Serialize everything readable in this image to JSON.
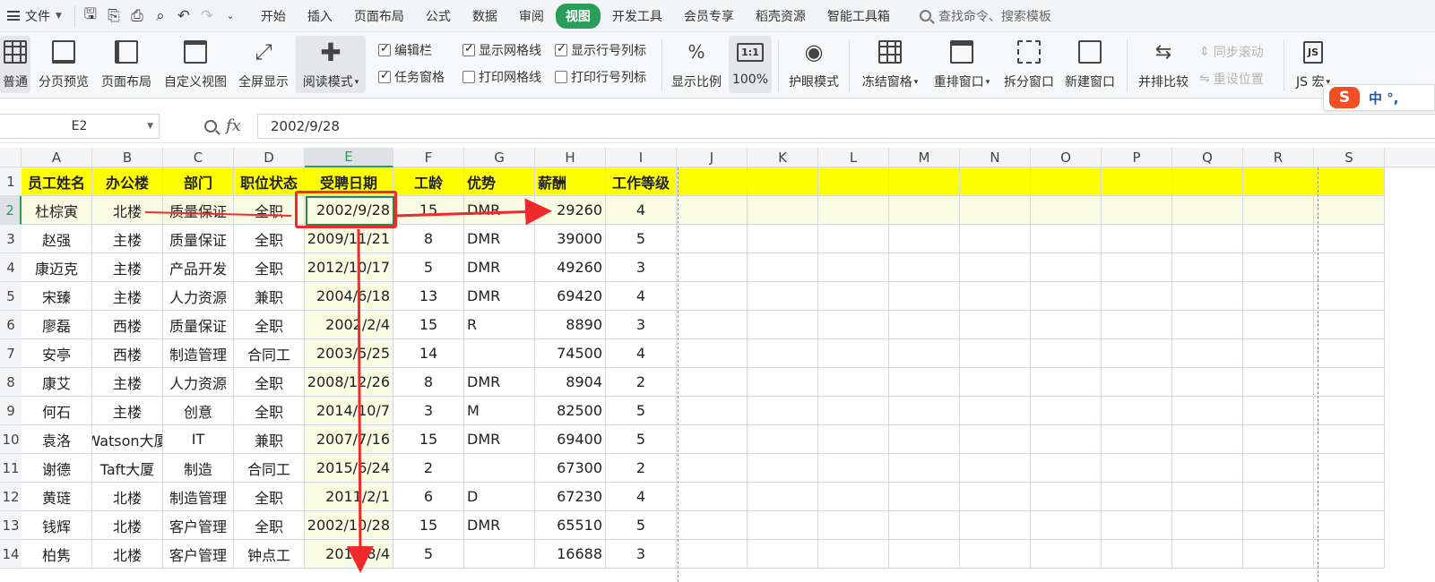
{
  "menu": {
    "file": "文件",
    "tabs": [
      {
        "label": "开始"
      },
      {
        "label": "插入"
      },
      {
        "label": "页面布局"
      },
      {
        "label": "公式"
      },
      {
        "label": "数据"
      },
      {
        "label": "审阅"
      },
      {
        "label": "视图",
        "active": true
      },
      {
        "label": "开发工具"
      },
      {
        "label": "会员专享"
      },
      {
        "label": "稻壳资源"
      },
      {
        "label": "智能工具箱"
      }
    ],
    "search": "查找命令、搜索模板"
  },
  "ribbon": {
    "normal": "普通",
    "page_break_preview": "分页预览",
    "page_layout": "页面布局",
    "custom_view": "自定义视图",
    "full_screen": "全屏显示",
    "reading_mode": "阅读模式",
    "edit_bar": "编辑栏",
    "task_pane": "任务窗格",
    "show_gridlines": "显示网格线",
    "print_gridlines": "打印网格线",
    "show_headings": "显示行号列标",
    "print_headings": "打印行号列标",
    "zoom_ratio": "显示比例",
    "zoom_100": "100%",
    "zoom_100_icon": "1:1",
    "eye_mode": "护眼模式",
    "freeze_panes": "冻结窗格",
    "arrange_windows": "重排窗口",
    "split_window": "拆分窗口",
    "new_window": "新建窗口",
    "side_by_side": "并排比较",
    "sync_scroll": "同步滚动",
    "reset_position": "重设位置",
    "js_macro": "JS 宏",
    "js_icon": "JS"
  },
  "ime": {
    "logo": "S",
    "text": "中 °,"
  },
  "formula_bar": {
    "name_box": "E2",
    "fx": "fx",
    "value": "2002/9/28"
  },
  "grid": {
    "columns": [
      "A",
      "B",
      "C",
      "D",
      "E",
      "F",
      "G",
      "H",
      "I",
      "J",
      "K",
      "L",
      "M",
      "N",
      "O",
      "P",
      "Q",
      "R",
      "S"
    ],
    "active_column": "E",
    "row_numbers": [
      "1",
      "2",
      "3",
      "4",
      "5",
      "6",
      "7",
      "8",
      "9",
      "10",
      "11",
      "12",
      "13",
      "14"
    ],
    "active_row": "2",
    "header_row": [
      "员工姓名",
      "办公楼",
      "部门",
      "职位状态",
      "受聘日期",
      "工龄",
      "优势",
      "薪酬",
      "工作等级"
    ],
    "rows": [
      [
        "杜棕寅",
        "北楼",
        "质量保证",
        "全职",
        "2002/9/28",
        "15",
        "DMR",
        "29260",
        "4"
      ],
      [
        "赵强",
        "主楼",
        "质量保证",
        "全职",
        "2009/11/21",
        "8",
        "DMR",
        "39000",
        "5"
      ],
      [
        "康迈克",
        "主楼",
        "产品开发",
        "全职",
        "2012/10/17",
        "5",
        "DMR",
        "49260",
        "3"
      ],
      [
        "宋臻",
        "主楼",
        "人力资源",
        "兼职",
        "2004/6/18",
        "13",
        "DMR",
        "69420",
        "4"
      ],
      [
        "廖磊",
        "西楼",
        "质量保证",
        "全职",
        "2002/2/4",
        "15",
        "R",
        "8890",
        "3"
      ],
      [
        "安亭",
        "西楼",
        "制造管理",
        "合同工",
        "2003/5/25",
        "14",
        "",
        "74500",
        "4"
      ],
      [
        "康艾",
        "主楼",
        "人力资源",
        "全职",
        "2008/12/26",
        "8",
        "DMR",
        "8904",
        "2"
      ],
      [
        "何石",
        "主楼",
        "创意",
        "全职",
        "2014/10/7",
        "3",
        "M",
        "82500",
        "5"
      ],
      [
        "袁洛",
        "Watson大厦",
        "IT",
        "兼职",
        "2007/7/16",
        "15",
        "DMR",
        "69400",
        "5"
      ],
      [
        "谢德",
        "Taft大厦",
        "制造",
        "合同工",
        "2015/6/24",
        "2",
        "",
        "67300",
        "2"
      ],
      [
        "黄琏",
        "北楼",
        "制造管理",
        "全职",
        "2011/2/1",
        "6",
        "D",
        "67230",
        "4"
      ],
      [
        "钱辉",
        "北楼",
        "客户管理",
        "全职",
        "2002/10/28",
        "15",
        "DMR",
        "65510",
        "5"
      ],
      [
        "柏隽",
        "北楼",
        "客户管理",
        "钟点工",
        "2012/8/4",
        "5",
        "",
        "16688",
        "3"
      ]
    ]
  },
  "colors": {
    "accent": "#2a9d5b",
    "header_fill": "#ffff00",
    "annotation": "#f02a2a"
  }
}
